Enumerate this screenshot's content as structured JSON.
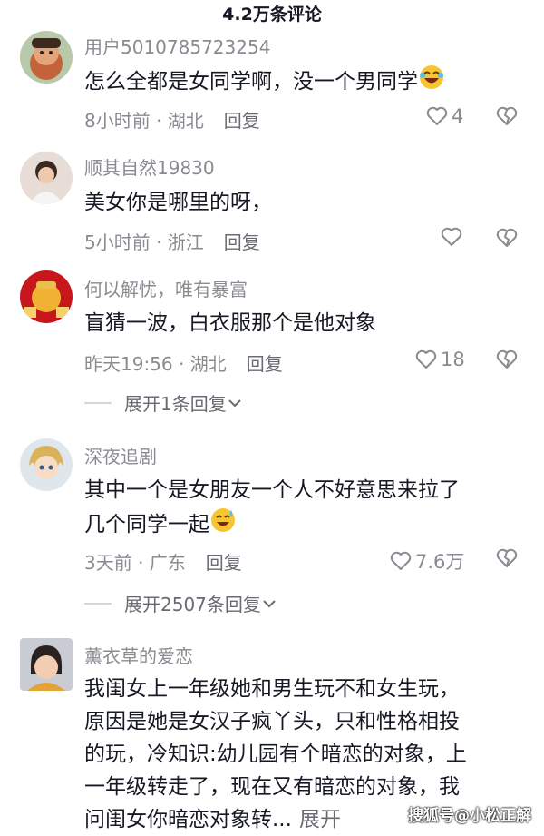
{
  "header": {
    "title": "4.2万条评论"
  },
  "comments": [
    {
      "username": "用户5010785723254",
      "text": "怎么全都是女同学啊，没一个男同学",
      "time_location": "8小时前 · 湖北",
      "reply_label": "回复",
      "likes": "4"
    },
    {
      "username": "顺其自然19830",
      "text": "美女你是哪里的呀，",
      "time_location": "5小时前 · 浙江",
      "reply_label": "回复",
      "likes": ""
    },
    {
      "username": "何以解忧，唯有暴富",
      "text": "盲猜一波，白衣服那个是他对象",
      "time_location": "昨天19:56 · 湖北",
      "reply_label": "回复",
      "likes": "18",
      "expand": "展开1条回复"
    },
    {
      "username": "深夜追剧",
      "text_line1": "其中一个是女朋友一个人不好意思来拉了",
      "text_line2": "几个同学一起",
      "time_location": "3天前 · 广东",
      "reply_label": "回复",
      "likes": "7.6万",
      "expand": "展开2507条回复"
    },
    {
      "username": "薰衣草的爱恋",
      "text_lines": [
        "我闺女上一年级她和男生玩不和女生玩，",
        "原因是她是女汉子疯丫头，只和性格相投",
        "的玩，冷知识:幼儿园有个暗恋的对象，上",
        "一年级转走了，现在又有暗恋的对象，我",
        "问闺女你暗恋对象转..."
      ],
      "more_label": "展开"
    }
  ],
  "watermark": "搜狐号@小松正解",
  "icons": {
    "heart": "heart-icon",
    "dislike": "dislike-icon",
    "chevron": "chevron-down-icon",
    "laugh_emoji": "laughing-emoji",
    "sweat_emoji": "sweat-smile-emoji"
  },
  "colors": {
    "secondary_text": "#8a8b91",
    "primary_text": "#161823"
  }
}
